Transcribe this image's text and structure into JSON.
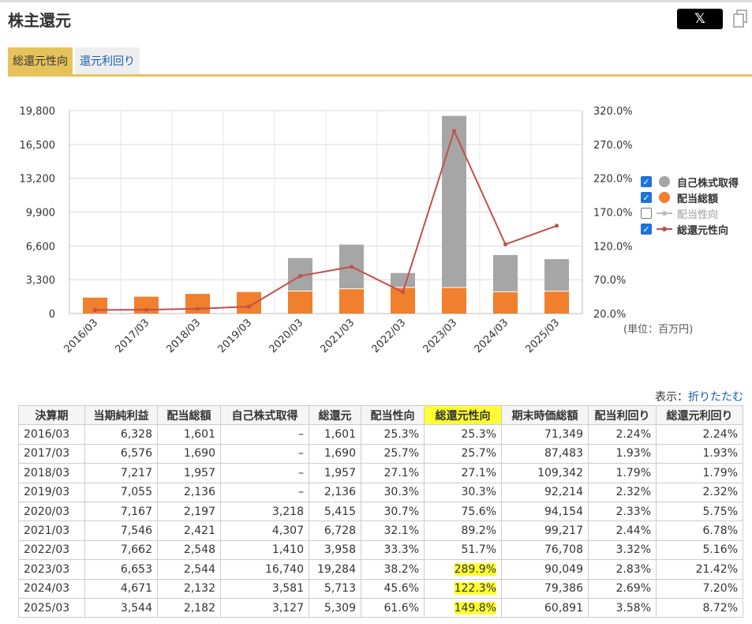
{
  "header": {
    "title": "株主還元",
    "share_label": "𝕏"
  },
  "tabs": [
    {
      "label": "総還元性向",
      "active": true
    },
    {
      "label": "還元利回り",
      "active": false
    }
  ],
  "unit_label": "(単位：百万円)",
  "display": {
    "prefix": "表示：",
    "link": "折りたたむ"
  },
  "colors": {
    "buyback": "#a6a6a6",
    "dividend": "#f07f2e",
    "payout_line": "#bbbbbb",
    "total_line": "#c0504d",
    "tab_accent": "#e6c35a",
    "highlight": "#ffff33"
  },
  "chart_data": {
    "type": "bar",
    "stacked": true,
    "categories": [
      "2016/03",
      "2017/03",
      "2018/03",
      "2019/03",
      "2020/03",
      "2021/03",
      "2022/03",
      "2023/03",
      "2024/03",
      "2025/03"
    ],
    "series": [
      {
        "name": "自己株式取得",
        "type": "bar",
        "axis": "left",
        "checked": true,
        "values": [
          0,
          0,
          0,
          0,
          3218,
          4307,
          1410,
          16740,
          3581,
          3127
        ]
      },
      {
        "name": "配当総額",
        "type": "bar",
        "axis": "left",
        "checked": true,
        "values": [
          1601,
          1690,
          1957,
          2136,
          2197,
          2421,
          2548,
          2544,
          2132,
          2182
        ]
      },
      {
        "name": "配当性向",
        "type": "line",
        "axis": "right",
        "checked": false,
        "values": [
          25.3,
          25.7,
          27.1,
          30.3,
          30.7,
          32.1,
          33.3,
          38.2,
          45.6,
          61.6
        ]
      },
      {
        "name": "総還元性向",
        "type": "line",
        "axis": "right",
        "checked": true,
        "values": [
          25.3,
          25.7,
          27.1,
          30.3,
          75.6,
          89.2,
          51.7,
          289.9,
          122.3,
          149.8
        ]
      }
    ],
    "y_left": {
      "min": 0,
      "max": 19800,
      "ticks": [
        "0",
        "3,300",
        "6,600",
        "9,900",
        "13,200",
        "16,500",
        "19,800"
      ]
    },
    "y_right": {
      "min": 20,
      "max": 320,
      "ticks": [
        "20.0%",
        "70.0%",
        "120.0%",
        "170.0%",
        "220.0%",
        "270.0%",
        "320.0%"
      ]
    },
    "grid": true,
    "legend": "right"
  },
  "table": {
    "headers": [
      "決算期",
      "当期純利益",
      "配当総額",
      "自己株式取得",
      "総還元",
      "配当性向",
      "総還元性向",
      "期末時価総額",
      "配当利回り",
      "総還元利回り"
    ],
    "rows": [
      [
        "2016/03",
        "6,328",
        "1,601",
        "–",
        "1,601",
        "25.3%",
        "25.3%",
        "71,349",
        "2.24%",
        "2.24%"
      ],
      [
        "2017/03",
        "6,576",
        "1,690",
        "–",
        "1,690",
        "25.7%",
        "25.7%",
        "87,483",
        "1.93%",
        "1.93%"
      ],
      [
        "2018/03",
        "7,217",
        "1,957",
        "–",
        "1,957",
        "27.1%",
        "27.1%",
        "109,342",
        "1.79%",
        "1.79%"
      ],
      [
        "2019/03",
        "7,055",
        "2,136",
        "–",
        "2,136",
        "30.3%",
        "30.3%",
        "92,214",
        "2.32%",
        "2.32%"
      ],
      [
        "2020/03",
        "7,167",
        "2,197",
        "3,218",
        "5,415",
        "30.7%",
        "75.6%",
        "94,154",
        "2.33%",
        "5.75%"
      ],
      [
        "2021/03",
        "7,546",
        "2,421",
        "4,307",
        "6,728",
        "32.1%",
        "89.2%",
        "99,217",
        "2.44%",
        "6.78%"
      ],
      [
        "2022/03",
        "7,662",
        "2,548",
        "1,410",
        "3,958",
        "33.3%",
        "51.7%",
        "76,708",
        "3.32%",
        "5.16%"
      ],
      [
        "2023/03",
        "6,653",
        "2,544",
        "16,740",
        "19,284",
        "38.2%",
        "289.9%",
        "90,049",
        "2.83%",
        "21.42%"
      ],
      [
        "2024/03",
        "4,671",
        "2,132",
        "3,581",
        "5,713",
        "45.6%",
        "122.3%",
        "79,386",
        "2.69%",
        "7.20%"
      ],
      [
        "2025/03",
        "3,544",
        "2,182",
        "3,127",
        "5,309",
        "61.6%",
        "149.8%",
        "60,891",
        "3.58%",
        "8.72%"
      ]
    ],
    "highlighted_cells": [
      [
        7,
        6
      ],
      [
        8,
        6
      ],
      [
        9,
        6
      ]
    ],
    "highlighted_header": 6
  }
}
